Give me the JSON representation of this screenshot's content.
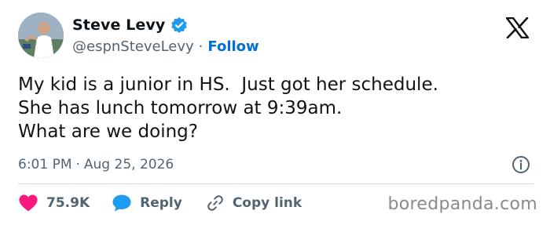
{
  "author": {
    "display_name": "Steve Levy",
    "handle": "@espnSteveLevy",
    "separator": "·",
    "follow_label": "Follow",
    "verified_color": "#1d9bf0"
  },
  "tweet": {
    "lines": [
      "My kid is a junior in HS.  Just got her schedule.",
      "She has lunch tomorrow at 9:39am.",
      "What are we doing?"
    ],
    "time": "6:01 PM",
    "separator": "·",
    "date": "Aug 25, 2026"
  },
  "actions": {
    "like_count": "75.9K",
    "like_color": "#f91880",
    "reply_label": "Reply",
    "reply_color": "#1d9bf0",
    "copy_link_label": "Copy link"
  },
  "icons": {
    "brand": "x-logo-icon",
    "verified": "verified-badge-icon",
    "info": "info-icon",
    "like": "heart-icon",
    "reply": "speech-bubble-icon",
    "copy_link": "link-icon"
  },
  "watermark": "boredpanda.com"
}
